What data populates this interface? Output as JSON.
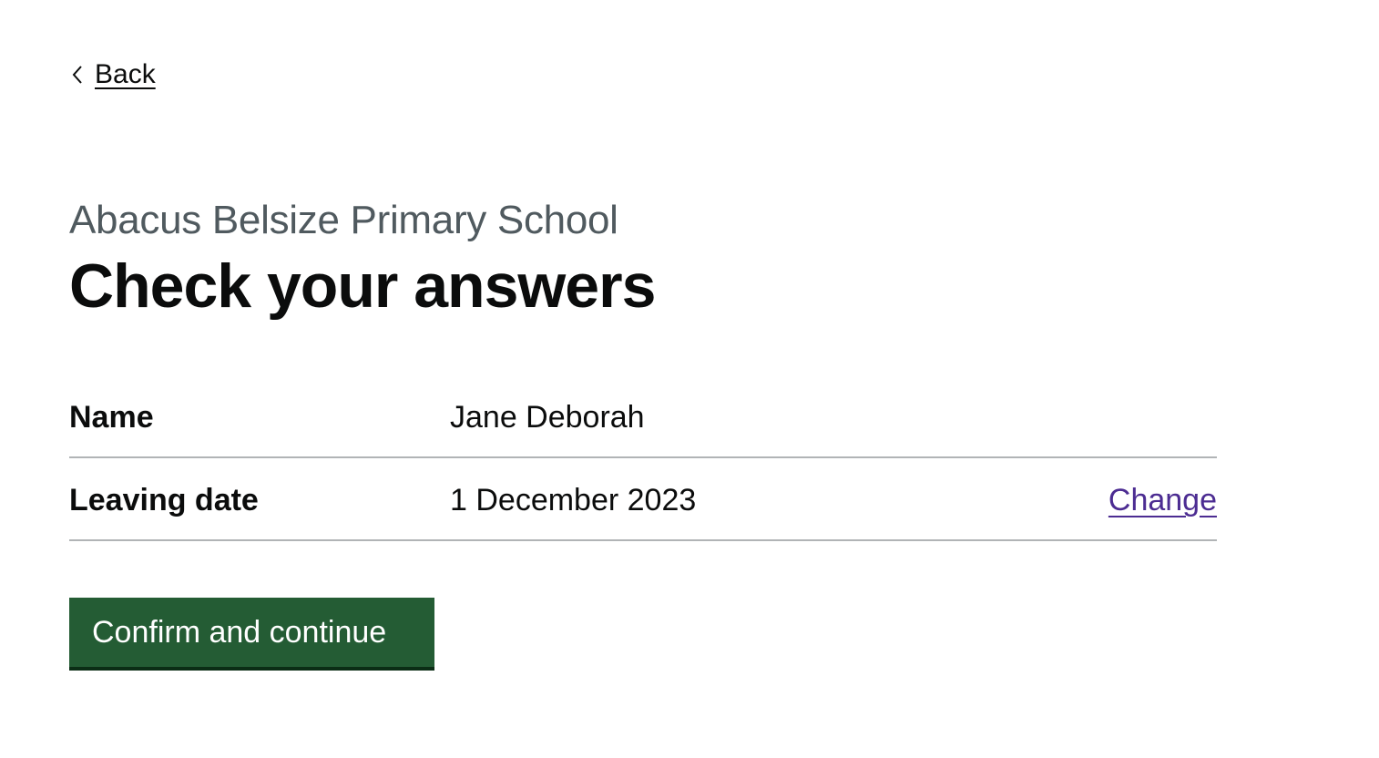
{
  "back_link": {
    "label": "Back",
    "icon": "chevron-left-icon"
  },
  "header": {
    "caption": "Abacus Belsize Primary School",
    "title": "Check your answers"
  },
  "summary": {
    "rows": [
      {
        "key": "Name",
        "value": "Jane Deborah",
        "action": ""
      },
      {
        "key": "Leaving date",
        "value": "1 December 2023",
        "action": "Change"
      }
    ]
  },
  "actions": {
    "confirm_label": "Confirm and continue"
  },
  "colors": {
    "text": "#0b0c0c",
    "caption": "#505a5f",
    "link": "#4c2c92",
    "button": "#245c34",
    "border": "#b1b4b6"
  }
}
